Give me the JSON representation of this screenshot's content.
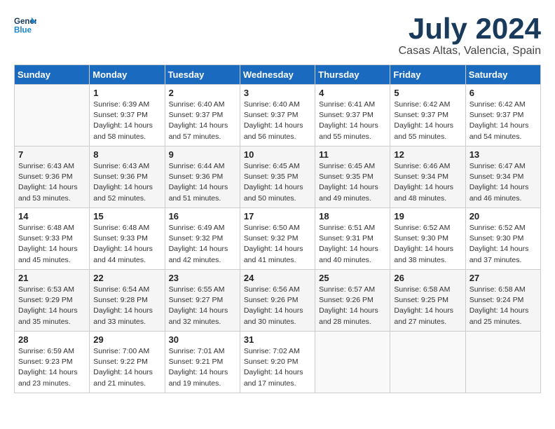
{
  "header": {
    "logo_line1": "General",
    "logo_line2": "Blue",
    "month": "July 2024",
    "location": "Casas Altas, Valencia, Spain"
  },
  "days_of_week": [
    "Sunday",
    "Monday",
    "Tuesday",
    "Wednesday",
    "Thursday",
    "Friday",
    "Saturday"
  ],
  "weeks": [
    [
      {
        "day": "",
        "empty": true
      },
      {
        "day": "1",
        "sunrise": "Sunrise: 6:39 AM",
        "sunset": "Sunset: 9:37 PM",
        "daylight": "Daylight: 14 hours and 58 minutes."
      },
      {
        "day": "2",
        "sunrise": "Sunrise: 6:40 AM",
        "sunset": "Sunset: 9:37 PM",
        "daylight": "Daylight: 14 hours and 57 minutes."
      },
      {
        "day": "3",
        "sunrise": "Sunrise: 6:40 AM",
        "sunset": "Sunset: 9:37 PM",
        "daylight": "Daylight: 14 hours and 56 minutes."
      },
      {
        "day": "4",
        "sunrise": "Sunrise: 6:41 AM",
        "sunset": "Sunset: 9:37 PM",
        "daylight": "Daylight: 14 hours and 55 minutes."
      },
      {
        "day": "5",
        "sunrise": "Sunrise: 6:42 AM",
        "sunset": "Sunset: 9:37 PM",
        "daylight": "Daylight: 14 hours and 55 minutes."
      },
      {
        "day": "6",
        "sunrise": "Sunrise: 6:42 AM",
        "sunset": "Sunset: 9:37 PM",
        "daylight": "Daylight: 14 hours and 54 minutes."
      }
    ],
    [
      {
        "day": "7",
        "sunrise": "Sunrise: 6:43 AM",
        "sunset": "Sunset: 9:36 PM",
        "daylight": "Daylight: 14 hours and 53 minutes."
      },
      {
        "day": "8",
        "sunrise": "Sunrise: 6:43 AM",
        "sunset": "Sunset: 9:36 PM",
        "daylight": "Daylight: 14 hours and 52 minutes."
      },
      {
        "day": "9",
        "sunrise": "Sunrise: 6:44 AM",
        "sunset": "Sunset: 9:36 PM",
        "daylight": "Daylight: 14 hours and 51 minutes."
      },
      {
        "day": "10",
        "sunrise": "Sunrise: 6:45 AM",
        "sunset": "Sunset: 9:35 PM",
        "daylight": "Daylight: 14 hours and 50 minutes."
      },
      {
        "day": "11",
        "sunrise": "Sunrise: 6:45 AM",
        "sunset": "Sunset: 9:35 PM",
        "daylight": "Daylight: 14 hours and 49 minutes."
      },
      {
        "day": "12",
        "sunrise": "Sunrise: 6:46 AM",
        "sunset": "Sunset: 9:34 PM",
        "daylight": "Daylight: 14 hours and 48 minutes."
      },
      {
        "day": "13",
        "sunrise": "Sunrise: 6:47 AM",
        "sunset": "Sunset: 9:34 PM",
        "daylight": "Daylight: 14 hours and 46 minutes."
      }
    ],
    [
      {
        "day": "14",
        "sunrise": "Sunrise: 6:48 AM",
        "sunset": "Sunset: 9:33 PM",
        "daylight": "Daylight: 14 hours and 45 minutes."
      },
      {
        "day": "15",
        "sunrise": "Sunrise: 6:48 AM",
        "sunset": "Sunset: 9:33 PM",
        "daylight": "Daylight: 14 hours and 44 minutes."
      },
      {
        "day": "16",
        "sunrise": "Sunrise: 6:49 AM",
        "sunset": "Sunset: 9:32 PM",
        "daylight": "Daylight: 14 hours and 42 minutes."
      },
      {
        "day": "17",
        "sunrise": "Sunrise: 6:50 AM",
        "sunset": "Sunset: 9:32 PM",
        "daylight": "Daylight: 14 hours and 41 minutes."
      },
      {
        "day": "18",
        "sunrise": "Sunrise: 6:51 AM",
        "sunset": "Sunset: 9:31 PM",
        "daylight": "Daylight: 14 hours and 40 minutes."
      },
      {
        "day": "19",
        "sunrise": "Sunrise: 6:52 AM",
        "sunset": "Sunset: 9:30 PM",
        "daylight": "Daylight: 14 hours and 38 minutes."
      },
      {
        "day": "20",
        "sunrise": "Sunrise: 6:52 AM",
        "sunset": "Sunset: 9:30 PM",
        "daylight": "Daylight: 14 hours and 37 minutes."
      }
    ],
    [
      {
        "day": "21",
        "sunrise": "Sunrise: 6:53 AM",
        "sunset": "Sunset: 9:29 PM",
        "daylight": "Daylight: 14 hours and 35 minutes."
      },
      {
        "day": "22",
        "sunrise": "Sunrise: 6:54 AM",
        "sunset": "Sunset: 9:28 PM",
        "daylight": "Daylight: 14 hours and 33 minutes."
      },
      {
        "day": "23",
        "sunrise": "Sunrise: 6:55 AM",
        "sunset": "Sunset: 9:27 PM",
        "daylight": "Daylight: 14 hours and 32 minutes."
      },
      {
        "day": "24",
        "sunrise": "Sunrise: 6:56 AM",
        "sunset": "Sunset: 9:26 PM",
        "daylight": "Daylight: 14 hours and 30 minutes."
      },
      {
        "day": "25",
        "sunrise": "Sunrise: 6:57 AM",
        "sunset": "Sunset: 9:26 PM",
        "daylight": "Daylight: 14 hours and 28 minutes."
      },
      {
        "day": "26",
        "sunrise": "Sunrise: 6:58 AM",
        "sunset": "Sunset: 9:25 PM",
        "daylight": "Daylight: 14 hours and 27 minutes."
      },
      {
        "day": "27",
        "sunrise": "Sunrise: 6:58 AM",
        "sunset": "Sunset: 9:24 PM",
        "daylight": "Daylight: 14 hours and 25 minutes."
      }
    ],
    [
      {
        "day": "28",
        "sunrise": "Sunrise: 6:59 AM",
        "sunset": "Sunset: 9:23 PM",
        "daylight": "Daylight: 14 hours and 23 minutes."
      },
      {
        "day": "29",
        "sunrise": "Sunrise: 7:00 AM",
        "sunset": "Sunset: 9:22 PM",
        "daylight": "Daylight: 14 hours and 21 minutes."
      },
      {
        "day": "30",
        "sunrise": "Sunrise: 7:01 AM",
        "sunset": "Sunset: 9:21 PM",
        "daylight": "Daylight: 14 hours and 19 minutes."
      },
      {
        "day": "31",
        "sunrise": "Sunrise: 7:02 AM",
        "sunset": "Sunset: 9:20 PM",
        "daylight": "Daylight: 14 hours and 17 minutes."
      },
      {
        "day": "",
        "empty": true
      },
      {
        "day": "",
        "empty": true
      },
      {
        "day": "",
        "empty": true
      }
    ]
  ]
}
